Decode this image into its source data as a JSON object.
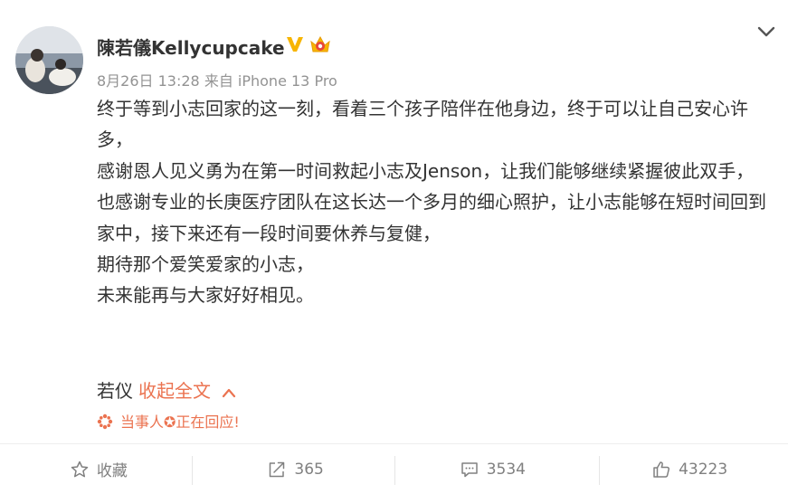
{
  "post": {
    "author": "陳若儀Kellycupcake",
    "meta": "8月26日 13:28 来自 iPhone 13 Pro",
    "lines": [
      "终于等到小志回家的这一刻，看着三个孩子陪伴在他身边，终于可以让自己安心许多，",
      "感谢恩人见义勇为在第一时间救起小志及Jenson，让我们能够继续紧握彼此双手，",
      "也感谢专业的长庚医疗团队在这长达一个多月的细心照护，让小志能够在短时间回到家中，接下来还有一段时间要休养与复健，",
      "期待那个爱笑爱家的小志，",
      "未来能再与大家好好相见。"
    ],
    "signature": "若仪",
    "collapse_label": "收起全文",
    "notice": "当事人✪正在回应!"
  },
  "actions": {
    "favorite_label": "收藏",
    "repost_count": "365",
    "comment_count": "3534",
    "like_count": "43223"
  },
  "colors": {
    "accent": "#eb7350",
    "badge_gold": "#f7b500",
    "text": "#333333",
    "muted": "#939393"
  }
}
